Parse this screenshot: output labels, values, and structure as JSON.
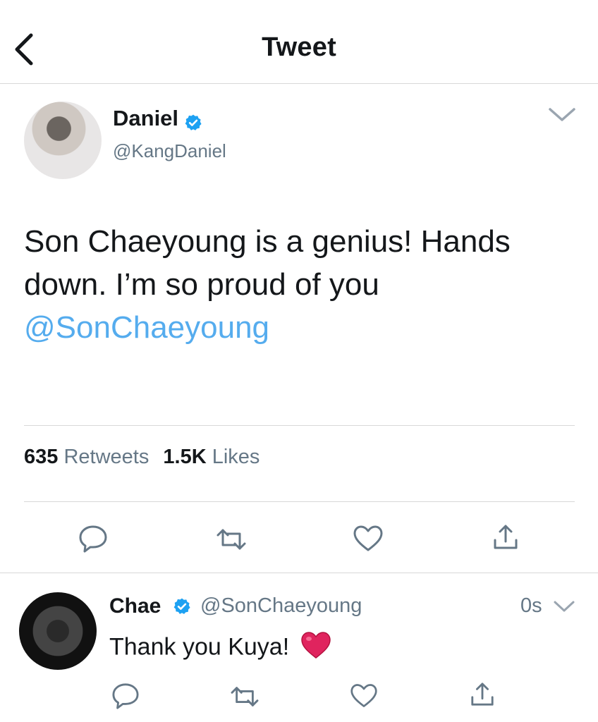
{
  "header": {
    "title": "Tweet"
  },
  "tweet": {
    "author_name": "Daniel",
    "author_handle": "@KangDaniel",
    "text": "Son Chaeyoung is a genius!  Hands down. I’m so proud of you",
    "mention": "@SonChaeyoung",
    "retweets_count": "635",
    "retweets_label": "Retweets",
    "likes_count": "1.5K",
    "likes_label": "Likes"
  },
  "reply": {
    "author_name": "Chae",
    "author_handle": "@SonChaeyoung",
    "time": "0s",
    "text": "Thank you Kuya!"
  },
  "colors": {
    "accent": "#55acee",
    "muted": "#657786",
    "divider": "#d8d8d8",
    "verified": "#1da1f2",
    "heart_emoji": "#e0245e"
  },
  "icons": [
    "back-arrow-icon",
    "verified-badge-icon",
    "chevron-down-icon",
    "reply-icon",
    "retweet-icon",
    "like-icon",
    "share-icon",
    "red-heart-emoji"
  ]
}
